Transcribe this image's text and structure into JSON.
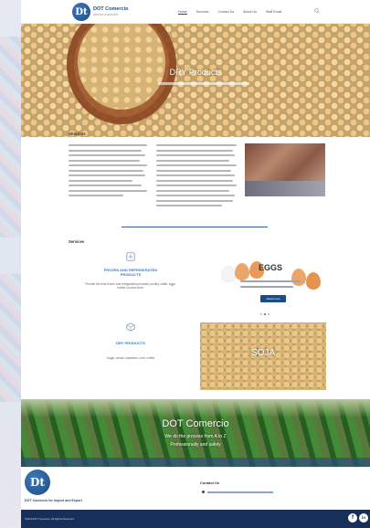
{
  "header": {
    "logo_mark": "Dt",
    "logo_title": "DOT Comercio",
    "logo_subtitle": "IMPORT & EXPORT",
    "nav": [
      "Home",
      "Services",
      "Contact Us",
      "About Us",
      "Staff Email"
    ]
  },
  "hero": {
    "title": "DRY Products"
  },
  "about": {
    "heading": "About Us"
  },
  "services": {
    "heading": "Services",
    "frozen_title": "FROZEN AND REFRIGERATED PRODUCTS",
    "frozen_text": "Provide the best frozen and refrigerated products: poultry, cattle, eggs, further cut and more.",
    "dry_title": "DRY PRODUCTS",
    "dry_text": "Sugar, cacao, soybeans, corn, coffee"
  },
  "eggs_slide": {
    "title": "EGGS",
    "button_label": "Read more",
    "dots_total": 3,
    "dots_active_index": 1
  },
  "soja": {
    "label": "SOJA"
  },
  "banner": {
    "title": "DOT Comercio",
    "line1": "We do the process from A to Z",
    "line2": "Professionally and safely"
  },
  "footer": {
    "logo_mark": "Dt",
    "logo_text": "DOT Comercio for Import and Export",
    "contact_heading": "Contact Us"
  },
  "bottom_bar": {
    "copyright": "©2019 DOT Comercio. All Rights Reserved.",
    "social": [
      "f",
      "in"
    ]
  },
  "colors": {
    "brand_blue": "#1b4c85",
    "accent_blue": "#3f79c0",
    "bottom_bar": "#17305a"
  }
}
